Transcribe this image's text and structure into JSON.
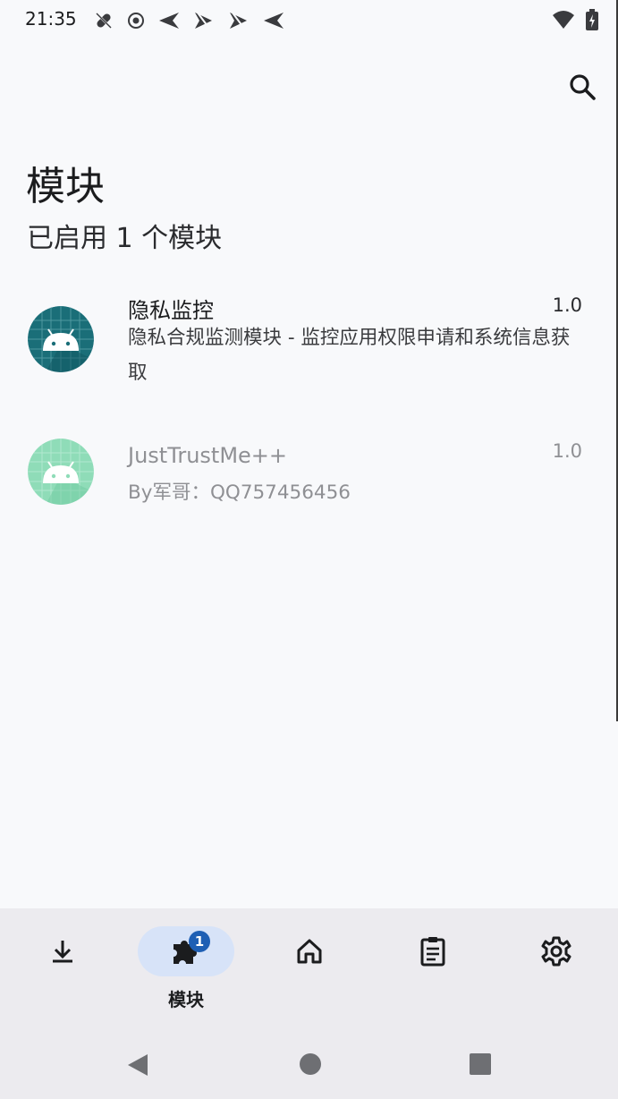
{
  "status_bar": {
    "time": "21:35",
    "notification_icons": [
      "bug-off-icon",
      "record-icon",
      "send-icon",
      "send-slash-icon",
      "send-slash-icon",
      "send-icon"
    ],
    "right_icons": [
      "wifi-icon",
      "battery-charging-icon"
    ]
  },
  "toolbar": {
    "search_icon": "search-icon"
  },
  "page": {
    "title": "模块",
    "subtitle": "已启用 1 个模块"
  },
  "modules": [
    {
      "name": "隐私监控",
      "version": "1.0",
      "description": "隐私合规监测模块 - 监控应用权限申请和系统信息获取",
      "enabled": true,
      "icon": "android-icon",
      "icon_bg": "#1a6e78"
    },
    {
      "name": "JustTrustMe++",
      "version": "1.0",
      "description": "By军哥：QQ757456456",
      "enabled": false,
      "icon": "android-icon",
      "icon_bg": "#8fdcb8"
    }
  ],
  "bottom_nav": {
    "items": [
      {
        "id": "download",
        "icon": "download-icon",
        "label": ""
      },
      {
        "id": "modules",
        "icon": "puzzle-icon",
        "label": "模块",
        "badge": "1",
        "active": true
      },
      {
        "id": "home",
        "icon": "home-icon",
        "label": ""
      },
      {
        "id": "logs",
        "icon": "clipboard-icon",
        "label": ""
      },
      {
        "id": "settings",
        "icon": "gear-icon",
        "label": ""
      }
    ],
    "active_bg": "#d7e3f8",
    "badge_color": "#1e5fb4"
  },
  "system_nav": {
    "back": "back-icon",
    "home": "home-circle-icon",
    "recents": "recents-icon"
  }
}
